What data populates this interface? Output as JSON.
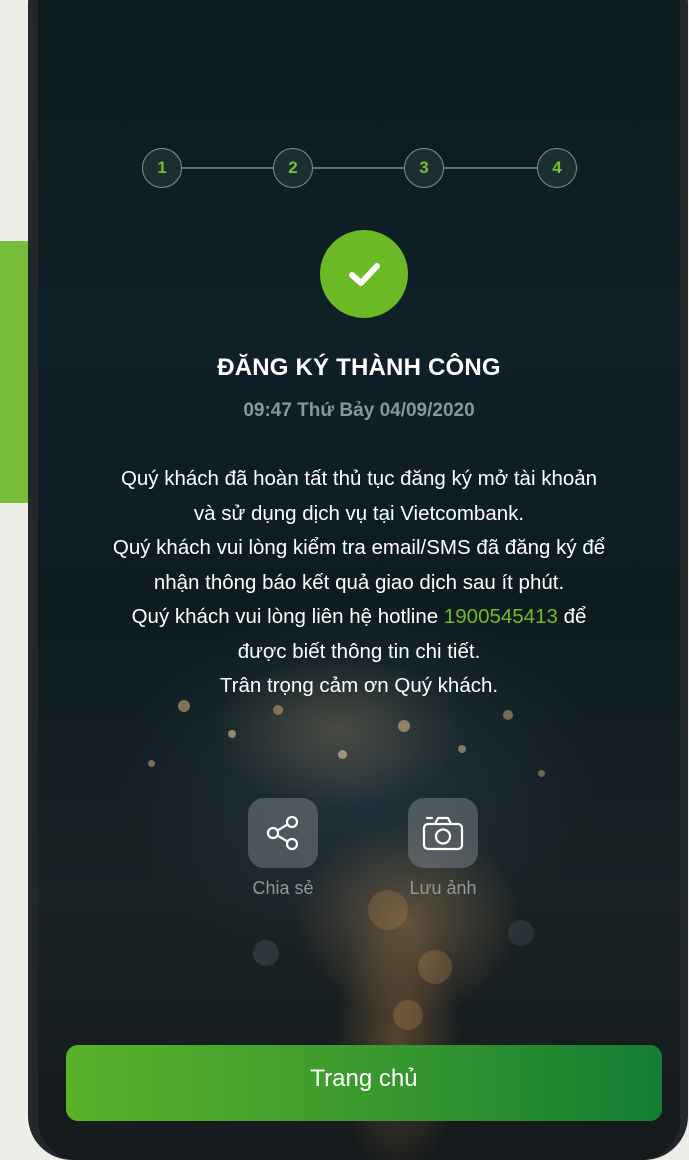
{
  "stepper": {
    "steps": [
      "1",
      "2",
      "3",
      "4"
    ],
    "current_step": 4
  },
  "result": {
    "status_icon": "check-icon",
    "title": "ĐĂNG KÝ THÀNH CÔNG",
    "timestamp": "09:47 Thứ Bảy 04/09/2020"
  },
  "message": {
    "line1": "Quý khách đã hoàn tất thủ tục đăng ký mở tài khoản và sử dụng dịch vụ tại Vietcombank.",
    "line2": "Quý khách vui lòng kiểm tra email/SMS đã đăng ký để nhận thông báo kết quả giao dịch sau ít phút.",
    "line3_prefix": "Quý khách vui lòng liên hệ hotline",
    "hotline": "1900545413",
    "line3_suffix": "để được biết thông tin chi tiết.",
    "line4": "Trân trọng cảm ơn Quý khách."
  },
  "actions": {
    "share": {
      "label": "Chia sẻ",
      "icon": "share-icon"
    },
    "save_image": {
      "label": "Lưu ảnh",
      "icon": "camera-icon"
    }
  },
  "home_button": {
    "label": "Trang chủ"
  },
  "colors": {
    "accent_green": "#6bba25",
    "background_dark": "#0f2026",
    "button_gradient_start": "#5ab22a",
    "button_gradient_end": "#137d33"
  }
}
